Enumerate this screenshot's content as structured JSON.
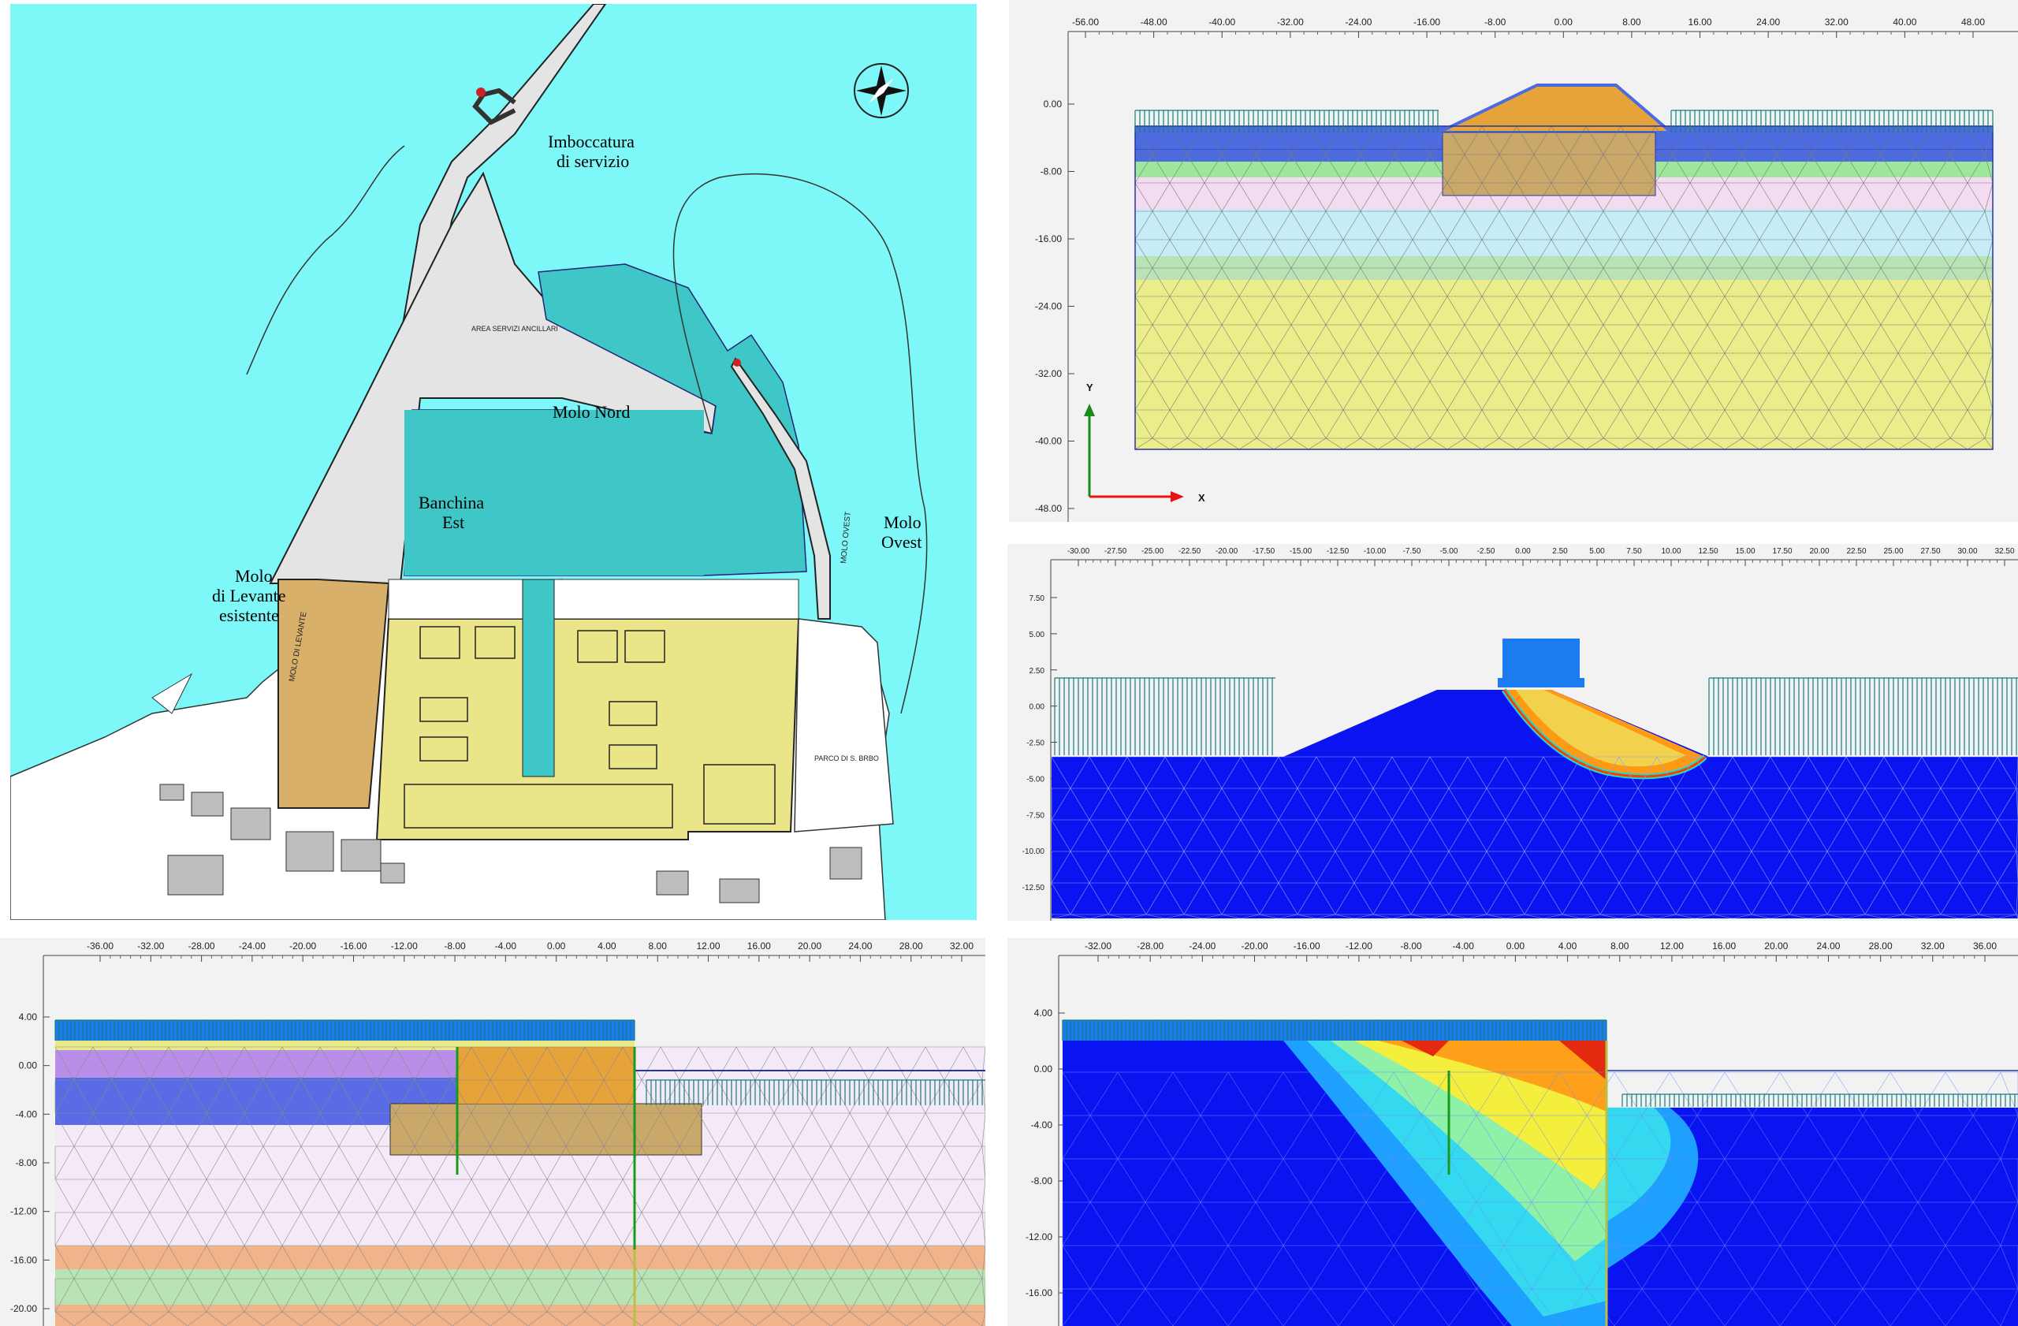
{
  "map": {
    "compass_icon": "compass-rose-icon",
    "labels": {
      "imboccatura": "Imboccatura",
      "imboccatura2": "di servizio",
      "molo_nord": "Molo Nord",
      "banchina": "Banchina",
      "banchina2": "Est",
      "molo_levante": "Molo",
      "molo_levante2": "di Levante",
      "molo_levante3": "esistente",
      "molo_ovest": "Molo",
      "molo_ovest2": "Ovest",
      "area_servizi": "AREA SERVIZI ANCILLARI",
      "molo_di_levante_small": "MOLO DI LEVANTE",
      "molo_ovest_small": "MOLO OVEST",
      "parco": "PARCO DI S. BRBO"
    },
    "colors": {
      "sea": "#7df7f7",
      "land": "#e6e6e6",
      "yard": "#e9e588",
      "dock": "#d8b06a",
      "basin": "#3fc6c6"
    }
  },
  "panels": {
    "top_right": {
      "x_ticks": [
        "-56.00",
        "-48.00",
        "-40.00",
        "-32.00",
        "-24.00",
        "-16.00",
        "-8.00",
        "0.00",
        "8.00",
        "16.00",
        "24.00",
        "32.00",
        "40.00",
        "48.00"
      ],
      "y_ticks": [
        "0.00",
        "-8.00",
        "-16.00",
        "-24.00",
        "-32.00",
        "-40.00",
        "-48.00"
      ],
      "axis_y": "Y",
      "axis_x": "X"
    },
    "middle_right": {
      "x_ticks": [
        "-30.00",
        "-27.50",
        "-25.00",
        "-22.50",
        "-20.00",
        "-17.50",
        "-15.00",
        "-12.50",
        "-10.00",
        "-7.50",
        "-5.00",
        "-2.50",
        "0.00",
        "2.50",
        "5.00",
        "7.50",
        "10.00",
        "12.50",
        "15.00",
        "17.50",
        "20.00",
        "22.50",
        "25.00",
        "27.50",
        "30.00",
        "32.50"
      ],
      "y_ticks": [
        "7.50",
        "5.00",
        "2.50",
        "0.00",
        "-2.50",
        "-5.00",
        "-7.50",
        "-10.00",
        "-12.50"
      ]
    },
    "bottom_left": {
      "x_ticks": [
        "-36.00",
        "-32.00",
        "-28.00",
        "-24.00",
        "-20.00",
        "-16.00",
        "-12.00",
        "-8.00",
        "-4.00",
        "0.00",
        "4.00",
        "8.00",
        "12.00",
        "16.00",
        "20.00",
        "24.00",
        "28.00",
        "32.00"
      ],
      "y_ticks": [
        "4.00",
        "0.00",
        "-4.00",
        "-8.00",
        "-12.00",
        "-16.00",
        "-20.00"
      ]
    },
    "bottom_right": {
      "x_ticks": [
        "-32.00",
        "-28.00",
        "-24.00",
        "-20.00",
        "-16.00",
        "-12.00",
        "-8.00",
        "-4.00",
        "0.00",
        "4.00",
        "8.00",
        "12.00",
        "16.00",
        "20.00",
        "24.00",
        "28.00",
        "32.00",
        "36.00"
      ],
      "y_ticks": [
        "4.00",
        "0.00",
        "-4.00",
        "-8.00",
        "-12.00",
        "-16.00"
      ]
    }
  }
}
